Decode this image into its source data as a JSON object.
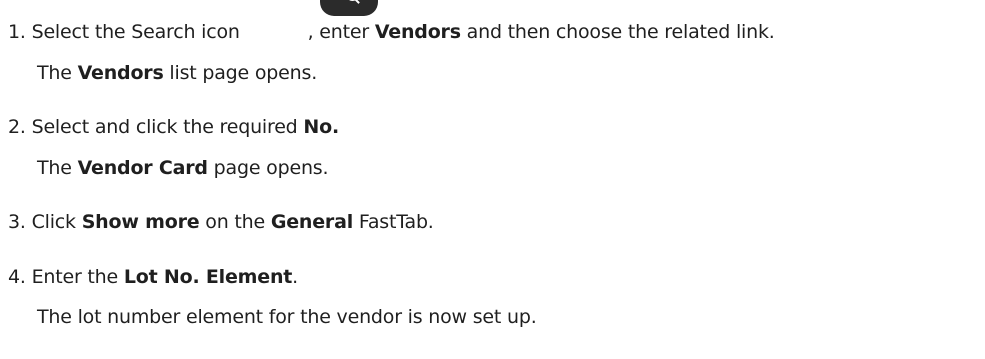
{
  "steps": [
    {
      "number": "1.",
      "parts": {
        "a": "Select the Search icon ",
        "b": ", enter ",
        "c": "Vendors",
        "d": " and then choose the related link."
      },
      "result": {
        "a": "The ",
        "b": "Vendors",
        "c": " list page opens."
      }
    },
    {
      "number": "2.",
      "parts": {
        "a": "Select and click the required ",
        "b": "No."
      },
      "result": {
        "a": "The ",
        "b": "Vendor Card",
        "c": " page opens."
      }
    },
    {
      "number": "3.",
      "parts": {
        "a": "Click ",
        "b": "Show more",
        "c": " on the ",
        "d": "General",
        "e": " FastTab."
      }
    },
    {
      "number": "4.",
      "parts": {
        "a": "Enter the ",
        "b": "Lot No. Element",
        "c": "."
      },
      "result": {
        "a": "The lot number element for the vendor is now set up."
      }
    }
  ],
  "icons": {
    "search": "search-icon"
  }
}
